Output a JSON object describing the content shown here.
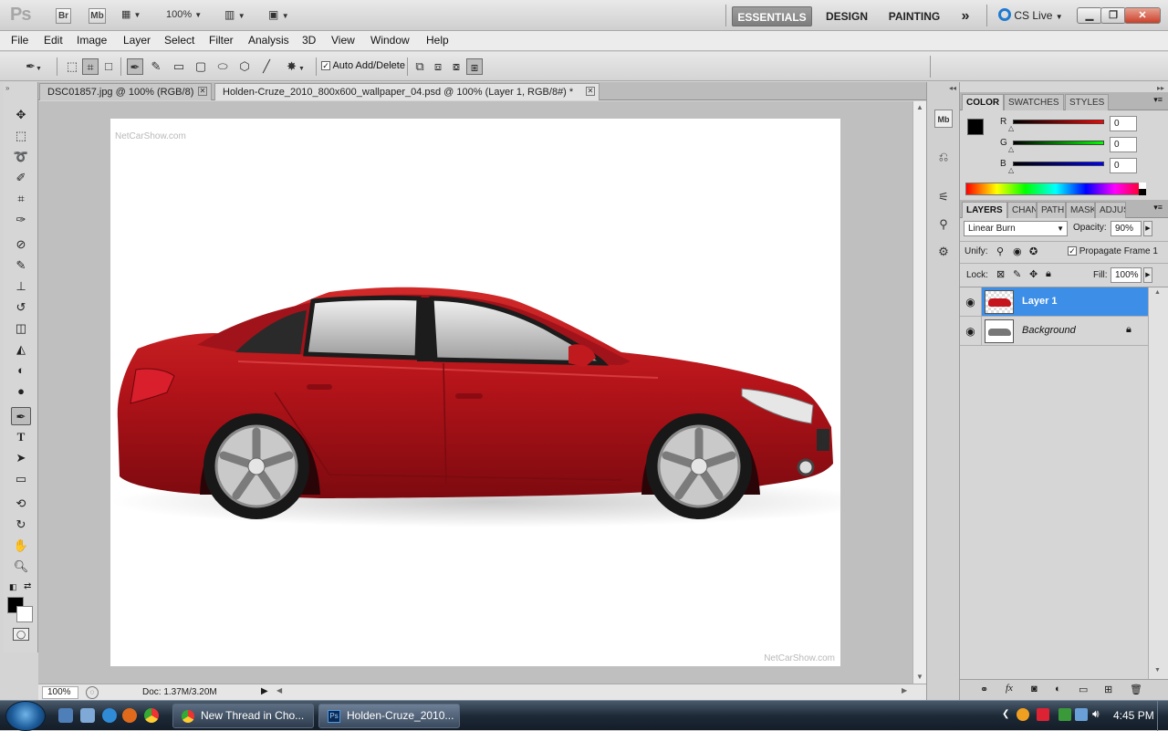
{
  "app_bar": {
    "logo": "Ps",
    "bridge_btn": "Br",
    "minibridge_btn": "Mb",
    "zoom": "100%",
    "workspaces": [
      "ESSENTIALS",
      "DESIGN",
      "PAINTING"
    ],
    "active_workspace": "ESSENTIALS",
    "overflow": "»",
    "cs_live": "CS Live"
  },
  "menu": [
    "File",
    "Edit",
    "Image",
    "Layer",
    "Select",
    "Filter",
    "Analysis",
    "3D",
    "View",
    "Window",
    "Help"
  ],
  "options_bar": {
    "auto_add_delete": "Auto Add/Delete"
  },
  "doc_tabs": [
    {
      "title": "DSC01857.jpg @ 100% (RGB/8)",
      "active": false
    },
    {
      "title": "Holden-Cruze_2010_800x600_wallpaper_04.psd @ 100% (Layer 1, RGB/8#) *",
      "active": true
    }
  ],
  "document": {
    "watermark_top": "NetCarShow.com",
    "watermark_bottom": "NetCarShow.com"
  },
  "status_bar": {
    "zoom": "100%",
    "doc_size": "Doc: 1.37M/3.20M"
  },
  "color_panel": {
    "tabs": [
      "COLOR",
      "SWATCHES",
      "STYLES"
    ],
    "channels": [
      {
        "label": "R",
        "value": "0",
        "color": "#e01010"
      },
      {
        "label": "G",
        "value": "0",
        "color": "#14b814"
      },
      {
        "label": "B",
        "value": "0",
        "color": "#1414d8"
      }
    ],
    "foreground": "#000000",
    "background": "#ffffff"
  },
  "layers_panel": {
    "tabs": [
      "LAYERS",
      "CHAN",
      "PATH",
      "MASK",
      "ADJUS"
    ],
    "blend_mode": "Linear Burn",
    "opacity_label": "Opacity:",
    "opacity": "90%",
    "unify_label": "Unify:",
    "propagate_label": "Propagate Frame 1",
    "lock_label": "Lock:",
    "fill_label": "Fill:",
    "fill": "100%",
    "layers": [
      {
        "name": "Layer 1",
        "selected": true
      },
      {
        "name": "Background",
        "selected": false,
        "locked": true
      }
    ]
  },
  "taskbar": {
    "buttons": [
      {
        "label": "New Thread in Cho..."
      },
      {
        "label": "Holden-Cruze_2010..."
      }
    ],
    "clock": "4:45 PM"
  }
}
